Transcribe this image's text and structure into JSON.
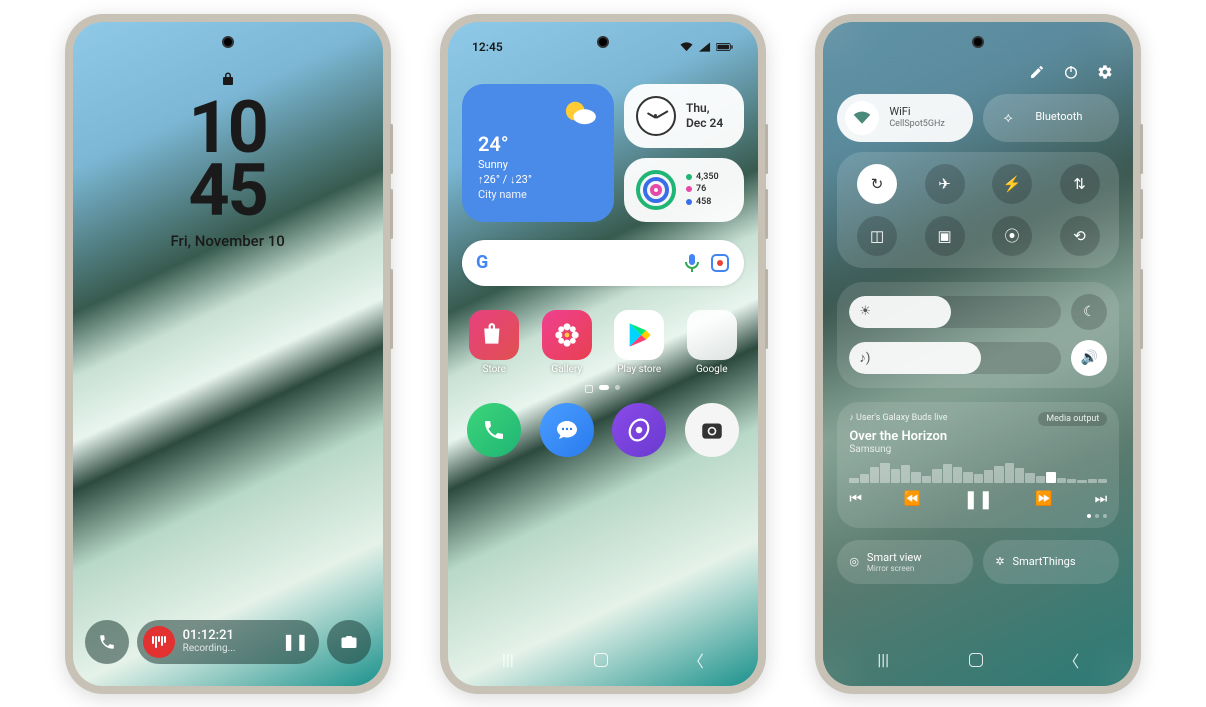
{
  "lockscreen": {
    "time_top": "10",
    "time_bottom": "45",
    "date": "Fri, November 10",
    "recording": {
      "time": "01:12:21",
      "label": "Recording..."
    }
  },
  "homescreen": {
    "status_time": "12:45",
    "weather": {
      "temp": "24°",
      "desc": "Sunny",
      "hilo": "↑26° / ↓23°",
      "city": "City name"
    },
    "clock_widget": {
      "line1": "Thu,",
      "line2": "Dec 24"
    },
    "health": {
      "steps": "4,350",
      "hr": "76",
      "cal": "458"
    },
    "apps": {
      "store": "Store",
      "gallery": "Gallery",
      "playstore": "Play store",
      "google": "Google"
    }
  },
  "quickpanel": {
    "wifi": {
      "title": "WiFi",
      "sub": "CellSpot5GHz"
    },
    "bluetooth": {
      "title": "Bluetooth"
    },
    "brightness_pct": 48,
    "volume_pct": 62,
    "media": {
      "device": "♪ User's Galaxy Buds live",
      "output": "Media output",
      "title": "Over the Horizon",
      "artist": "Samsung"
    },
    "smartview": {
      "title": "Smart view",
      "sub": "Mirror screen"
    },
    "smartthings": "SmartThings"
  }
}
